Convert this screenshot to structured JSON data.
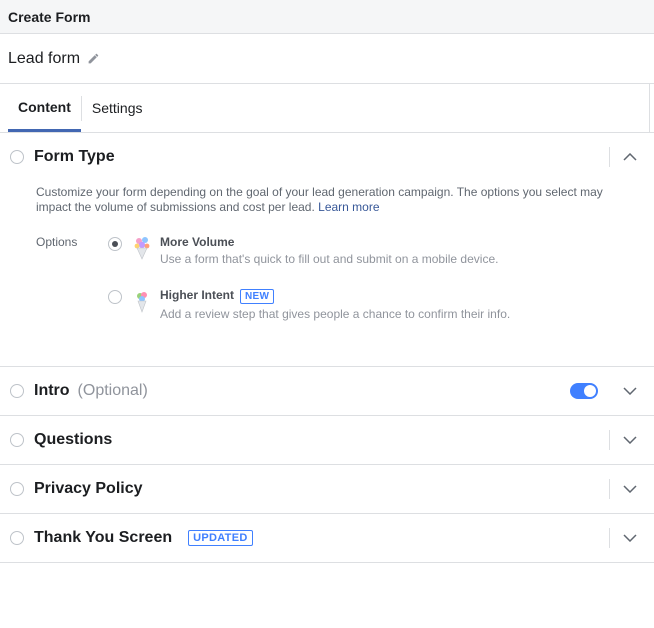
{
  "header": {
    "title": "Create Form"
  },
  "form": {
    "name": "Lead form"
  },
  "tabs": [
    {
      "label": "Content",
      "active": true
    },
    {
      "label": "Settings",
      "active": false
    }
  ],
  "sections": {
    "form_type": {
      "title": "Form Type",
      "description": "Customize your form depending on the goal of your lead generation campaign. The options you select may impact the volume of submissions and cost per lead.",
      "learn_more": "Learn more",
      "options_label": "Options",
      "options": [
        {
          "title": "More Volume",
          "description": "Use a form that's quick to fill out and submit on a mobile device.",
          "selected": true
        },
        {
          "title": "Higher Intent",
          "badge": "NEW",
          "description": "Add a review step that gives people a chance to confirm their info.",
          "selected": false
        }
      ]
    },
    "intro": {
      "title": "Intro",
      "optional": "(Optional)",
      "toggle_on": true
    },
    "questions": {
      "title": "Questions"
    },
    "privacy": {
      "title": "Privacy Policy"
    },
    "thank_you": {
      "title": "Thank You Screen",
      "badge": "UPDATED"
    }
  },
  "colors": {
    "accent": "#4267b2",
    "badge": "#4080ff",
    "toggle": "#4080ff"
  }
}
